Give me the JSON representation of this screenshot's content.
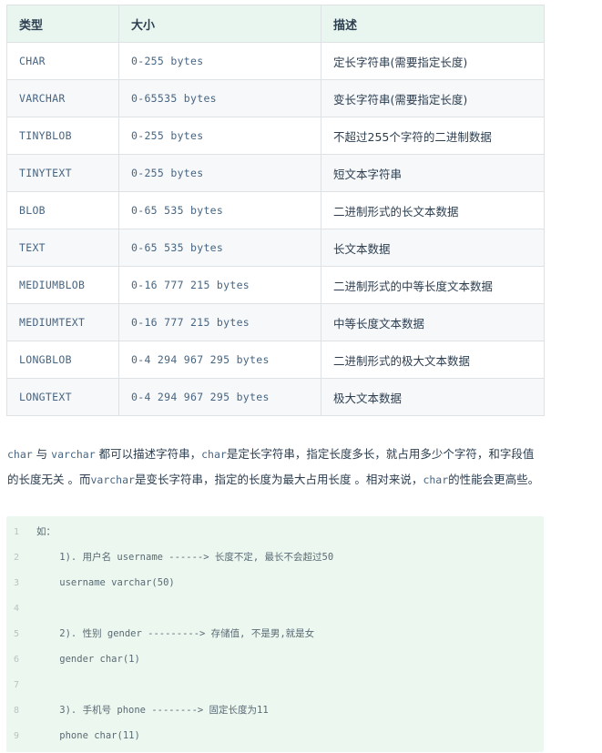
{
  "table": {
    "headers": [
      "类型",
      "大小",
      "描述"
    ],
    "rows": [
      {
        "type": "CHAR",
        "size": "0-255 bytes",
        "desc": "定长字符串(需要指定长度)"
      },
      {
        "type": "VARCHAR",
        "size": "0-65535 bytes",
        "desc": "变长字符串(需要指定长度)"
      },
      {
        "type": "TINYBLOB",
        "size": "0-255 bytes",
        "desc": "不超过255个字符的二进制数据"
      },
      {
        "type": "TINYTEXT",
        "size": "0-255 bytes",
        "desc": "短文本字符串"
      },
      {
        "type": "BLOB",
        "size": "0-65 535 bytes",
        "desc": "二进制形式的长文本数据"
      },
      {
        "type": "TEXT",
        "size": "0-65 535 bytes",
        "desc": "长文本数据"
      },
      {
        "type": "MEDIUMBLOB",
        "size": "0-16 777 215 bytes",
        "desc": "二进制形式的中等长度文本数据"
      },
      {
        "type": "MEDIUMTEXT",
        "size": "0-16 777 215 bytes",
        "desc": "中等长度文本数据"
      },
      {
        "type": "LONGBLOB",
        "size": "0-4 294 967 295 bytes",
        "desc": "二进制形式的极大文本数据"
      },
      {
        "type": "LONGTEXT",
        "size": "0-4 294 967 295 bytes",
        "desc": "极大文本数据"
      }
    ]
  },
  "paragraph": {
    "code_char": "char",
    "t_and": " 与 ",
    "code_varchar": "varchar",
    "t1": " 都可以描述字符串，",
    "code_char2": "char",
    "t2": "是定长字符串，指定长度多长，就占用多少个字符，和字段值的长度无关 。而",
    "code_varchar2": "varchar",
    "t3": "是变长字符串，指定的长度为最大占用长度 。相对来说，",
    "code_char3": "char",
    "t4": "的性能会更高些。"
  },
  "code_block": {
    "lines": [
      {
        "num": "1",
        "text": "如："
      },
      {
        "num": "2",
        "text": "    1). 用户名 username ------> 长度不定, 最长不会超过50"
      },
      {
        "num": "3",
        "text": "    username varchar(50)"
      },
      {
        "num": "4",
        "text": ""
      },
      {
        "num": "5",
        "text": "    2). 性别 gender ---------> 存储值, 不是男,就是女"
      },
      {
        "num": "6",
        "text": "    gender char(1)"
      },
      {
        "num": "7",
        "text": ""
      },
      {
        "num": "8",
        "text": "    3). 手机号 phone --------> 固定长度为11"
      },
      {
        "num": "9",
        "text": "    phone char(11)"
      }
    ]
  }
}
